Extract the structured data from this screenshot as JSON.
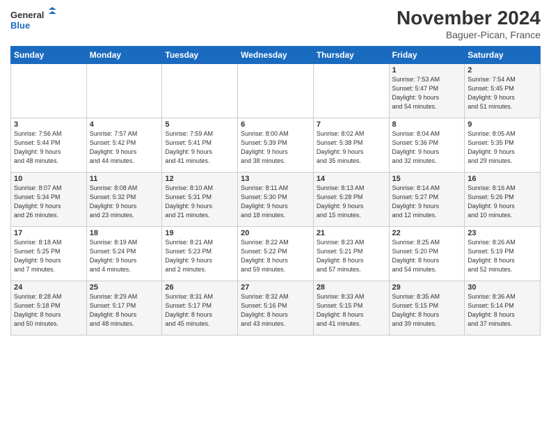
{
  "header": {
    "logo_line1": "General",
    "logo_line2": "Blue",
    "title": "November 2024",
    "location": "Baguer-Pican, France"
  },
  "weekdays": [
    "Sunday",
    "Monday",
    "Tuesday",
    "Wednesday",
    "Thursday",
    "Friday",
    "Saturday"
  ],
  "weeks": [
    [
      {
        "day": "",
        "info": ""
      },
      {
        "day": "",
        "info": ""
      },
      {
        "day": "",
        "info": ""
      },
      {
        "day": "",
        "info": ""
      },
      {
        "day": "",
        "info": ""
      },
      {
        "day": "1",
        "info": "Sunrise: 7:53 AM\nSunset: 5:47 PM\nDaylight: 9 hours\nand 54 minutes."
      },
      {
        "day": "2",
        "info": "Sunrise: 7:54 AM\nSunset: 5:45 PM\nDaylight: 9 hours\nand 51 minutes."
      }
    ],
    [
      {
        "day": "3",
        "info": "Sunrise: 7:56 AM\nSunset: 5:44 PM\nDaylight: 9 hours\nand 48 minutes."
      },
      {
        "day": "4",
        "info": "Sunrise: 7:57 AM\nSunset: 5:42 PM\nDaylight: 9 hours\nand 44 minutes."
      },
      {
        "day": "5",
        "info": "Sunrise: 7:59 AM\nSunset: 5:41 PM\nDaylight: 9 hours\nand 41 minutes."
      },
      {
        "day": "6",
        "info": "Sunrise: 8:00 AM\nSunset: 5:39 PM\nDaylight: 9 hours\nand 38 minutes."
      },
      {
        "day": "7",
        "info": "Sunrise: 8:02 AM\nSunset: 5:38 PM\nDaylight: 9 hours\nand 35 minutes."
      },
      {
        "day": "8",
        "info": "Sunrise: 8:04 AM\nSunset: 5:36 PM\nDaylight: 9 hours\nand 32 minutes."
      },
      {
        "day": "9",
        "info": "Sunrise: 8:05 AM\nSunset: 5:35 PM\nDaylight: 9 hours\nand 29 minutes."
      }
    ],
    [
      {
        "day": "10",
        "info": "Sunrise: 8:07 AM\nSunset: 5:34 PM\nDaylight: 9 hours\nand 26 minutes."
      },
      {
        "day": "11",
        "info": "Sunrise: 8:08 AM\nSunset: 5:32 PM\nDaylight: 9 hours\nand 23 minutes."
      },
      {
        "day": "12",
        "info": "Sunrise: 8:10 AM\nSunset: 5:31 PM\nDaylight: 9 hours\nand 21 minutes."
      },
      {
        "day": "13",
        "info": "Sunrise: 8:11 AM\nSunset: 5:30 PM\nDaylight: 9 hours\nand 18 minutes."
      },
      {
        "day": "14",
        "info": "Sunrise: 8:13 AM\nSunset: 5:28 PM\nDaylight: 9 hours\nand 15 minutes."
      },
      {
        "day": "15",
        "info": "Sunrise: 8:14 AM\nSunset: 5:27 PM\nDaylight: 9 hours\nand 12 minutes."
      },
      {
        "day": "16",
        "info": "Sunrise: 8:16 AM\nSunset: 5:26 PM\nDaylight: 9 hours\nand 10 minutes."
      }
    ],
    [
      {
        "day": "17",
        "info": "Sunrise: 8:18 AM\nSunset: 5:25 PM\nDaylight: 9 hours\nand 7 minutes."
      },
      {
        "day": "18",
        "info": "Sunrise: 8:19 AM\nSunset: 5:24 PM\nDaylight: 9 hours\nand 4 minutes."
      },
      {
        "day": "19",
        "info": "Sunrise: 8:21 AM\nSunset: 5:23 PM\nDaylight: 9 hours\nand 2 minutes."
      },
      {
        "day": "20",
        "info": "Sunrise: 8:22 AM\nSunset: 5:22 PM\nDaylight: 8 hours\nand 59 minutes."
      },
      {
        "day": "21",
        "info": "Sunrise: 8:23 AM\nSunset: 5:21 PM\nDaylight: 8 hours\nand 57 minutes."
      },
      {
        "day": "22",
        "info": "Sunrise: 8:25 AM\nSunset: 5:20 PM\nDaylight: 8 hours\nand 54 minutes."
      },
      {
        "day": "23",
        "info": "Sunrise: 8:26 AM\nSunset: 5:19 PM\nDaylight: 8 hours\nand 52 minutes."
      }
    ],
    [
      {
        "day": "24",
        "info": "Sunrise: 8:28 AM\nSunset: 5:18 PM\nDaylight: 8 hours\nand 50 minutes."
      },
      {
        "day": "25",
        "info": "Sunrise: 8:29 AM\nSunset: 5:17 PM\nDaylight: 8 hours\nand 48 minutes."
      },
      {
        "day": "26",
        "info": "Sunrise: 8:31 AM\nSunset: 5:17 PM\nDaylight: 8 hours\nand 45 minutes."
      },
      {
        "day": "27",
        "info": "Sunrise: 8:32 AM\nSunset: 5:16 PM\nDaylight: 8 hours\nand 43 minutes."
      },
      {
        "day": "28",
        "info": "Sunrise: 8:33 AM\nSunset: 5:15 PM\nDaylight: 8 hours\nand 41 minutes."
      },
      {
        "day": "29",
        "info": "Sunrise: 8:35 AM\nSunset: 5:15 PM\nDaylight: 8 hours\nand 39 minutes."
      },
      {
        "day": "30",
        "info": "Sunrise: 8:36 AM\nSunset: 5:14 PM\nDaylight: 8 hours\nand 37 minutes."
      }
    ]
  ]
}
